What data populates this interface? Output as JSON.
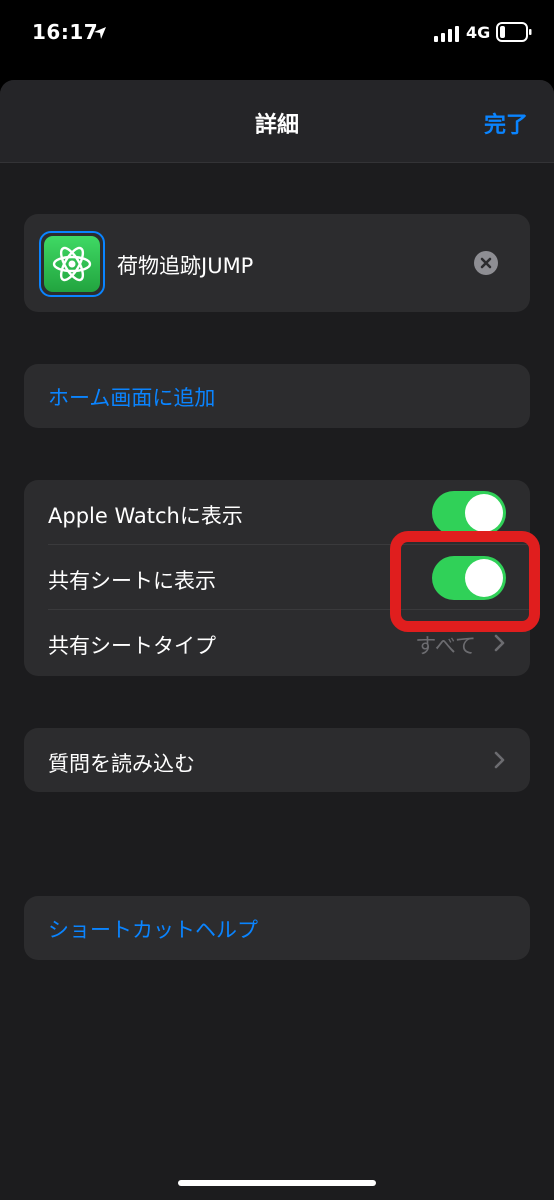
{
  "status_bar": {
    "time": "16:17",
    "network": "4G"
  },
  "nav": {
    "title": "詳細",
    "done_label": "完了"
  },
  "shortcut": {
    "name": "荷物追跡JUMP",
    "icon": "atom-icon"
  },
  "home_screen": {
    "label": "ホーム画面に追加"
  },
  "settings": {
    "rows": [
      {
        "label": "Apple Watchに表示",
        "toggle": true
      },
      {
        "label": "共有シートに表示",
        "toggle": true
      },
      {
        "label": "共有シートタイプ",
        "value": "すべて"
      }
    ]
  },
  "questions": {
    "label": "質問を読み込む"
  },
  "help": {
    "label": "ショートカットヘルプ"
  },
  "colors": {
    "accent": "#0a84ff",
    "toggle_on": "#30d158",
    "highlight": "#e01e1e",
    "card": "#2c2c2e",
    "background": "#1c1c1e"
  }
}
